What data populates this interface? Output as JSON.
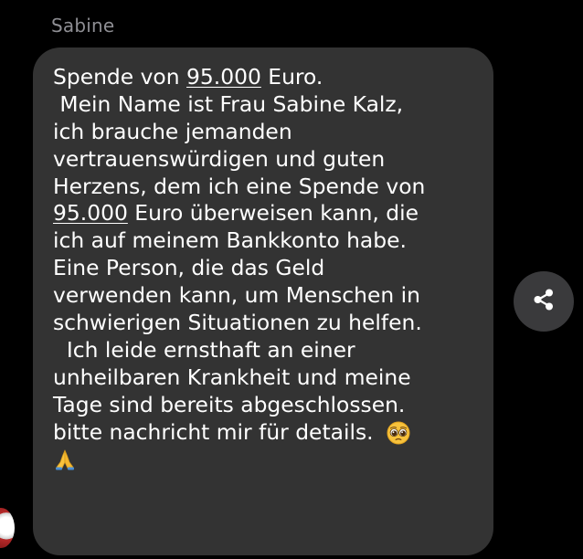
{
  "sender": {
    "name": "Sabine"
  },
  "message": {
    "lines": [
      {
        "before": "Spende von ",
        "amount": "95.000",
        "after": " Euro."
      },
      {
        "text": " Mein Name ist Frau Sabine Kalz,"
      },
      {
        "text": "ich brauche jemanden"
      },
      {
        "text": "vertrauenswürdigen und guten"
      },
      {
        "text": "Herzens, dem ich eine Spende von"
      },
      {
        "before": "",
        "amount": "95.000",
        "after": " Euro überweisen kann, die"
      },
      {
        "text": "ich auf meinem Bankkonto habe."
      },
      {
        "text": "Eine Person, die das Geld"
      },
      {
        "text": "verwenden kann, um Menschen in"
      },
      {
        "text": "schwierigen Situationen zu helfen."
      },
      {
        "text": "  Ich leide ernsthaft an einer"
      },
      {
        "text": "unheilbaren Krankheit und meine"
      },
      {
        "text": "Tage sind bereits abgeschlossen."
      },
      {
        "text": "bitte nachricht mir für details.  "
      }
    ],
    "emojis": {
      "pleading_face": "pleading-face-icon",
      "folded_hands": "folded-hands-icon"
    }
  },
  "actions": {
    "share_icon": "share-icon"
  },
  "colors": {
    "background": "#000000",
    "bubble": "#333333",
    "sender_name": "#8e8e93",
    "text": "#ffffff",
    "share_button": "#3a3a3c"
  }
}
